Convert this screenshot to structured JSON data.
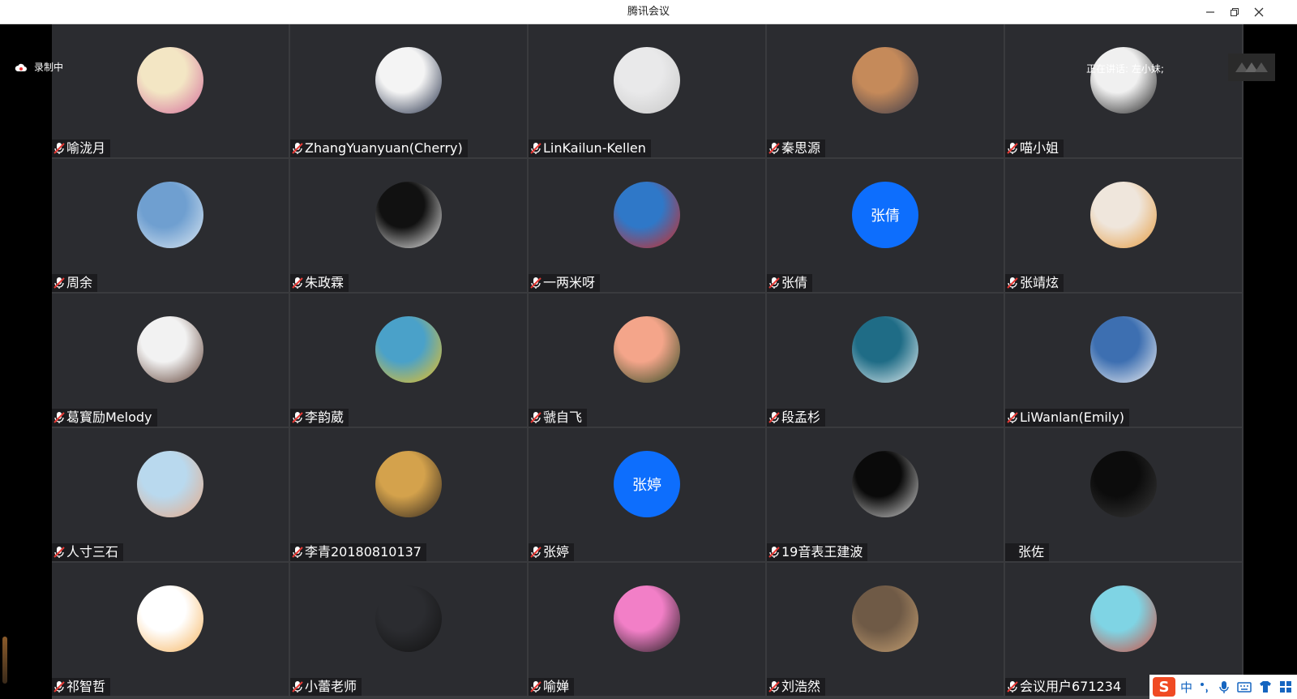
{
  "window": {
    "title": "腾讯会议"
  },
  "status": {
    "recording_label": "录制中",
    "speaking_label": "正在讲话: 左小妹;"
  },
  "colors": {
    "tile_bg": "#2b2c30",
    "text_avatar_bg": "#0d6efd",
    "recording_icon": "#ffffff"
  },
  "participants": [
    {
      "name": "喻泷月",
      "muted": true,
      "avatar_icon": "cartoon-girl-avatar",
      "avatar_colors": [
        "#f3e6c4",
        "#d46a9a"
      ]
    },
    {
      "name": "ZhangYuanyuan(Cherry)",
      "muted": true,
      "avatar_icon": "woman-photo-avatar",
      "avatar_colors": [
        "#f4f4f4",
        "#1f2a44"
      ]
    },
    {
      "name": "LinKailun-Kellen",
      "muted": true,
      "avatar_icon": "man-white-shirt-avatar",
      "avatar_colors": [
        "#e9e9ea",
        "#c7c7c7"
      ]
    },
    {
      "name": "秦思源",
      "muted": true,
      "avatar_icon": "sunset-lake-avatar",
      "avatar_colors": [
        "#c58a5a",
        "#3a3a4a"
      ]
    },
    {
      "name": "喵小姐",
      "muted": true,
      "avatar_icon": "dark-figure-avatar",
      "avatar_colors": [
        "#f0f0f0",
        "#1a1a1a"
      ]
    },
    {
      "name": "周余",
      "muted": true,
      "avatar_icon": "snow-mountain-avatar",
      "avatar_colors": [
        "#6f9fd0",
        "#dde8f2"
      ]
    },
    {
      "name": "朱政霖",
      "muted": true,
      "avatar_icon": "black-white-plush-avatar",
      "avatar_colors": [
        "#111111",
        "#f3f3f3"
      ]
    },
    {
      "name": "一两米呀",
      "muted": true,
      "avatar_icon": "red-hat-girl-avatar",
      "avatar_colors": [
        "#2f78c8",
        "#d3271f"
      ]
    },
    {
      "name": "张倩",
      "muted": true,
      "avatar_text": "张倩"
    },
    {
      "name": "张靖炫",
      "muted": true,
      "avatar_icon": "girl-tiger-illustration-avatar",
      "avatar_colors": [
        "#efe6dc",
        "#e69a3c"
      ]
    },
    {
      "name": "葛寳励Melody",
      "muted": true,
      "avatar_icon": "woman-flowers-avatar",
      "avatar_colors": [
        "#f2f2f2",
        "#5a3a2e"
      ]
    },
    {
      "name": "李韵葳",
      "muted": true,
      "avatar_icon": "yellow-flower-avatar",
      "avatar_colors": [
        "#4aa1c9",
        "#f1c21b"
      ]
    },
    {
      "name": "虢自飞",
      "muted": true,
      "avatar_icon": "pink-rose-avatar",
      "avatar_colors": [
        "#f4a58a",
        "#2e4a22"
      ]
    },
    {
      "name": "段孟杉",
      "muted": true,
      "avatar_icon": "ocean-wave-avatar",
      "avatar_colors": [
        "#1f6c86",
        "#e7f1f3"
      ]
    },
    {
      "name": "LiWanlan(Emily)",
      "muted": true,
      "avatar_icon": "woman-santorini-avatar",
      "avatar_colors": [
        "#3d6fb1",
        "#f3f3f3"
      ]
    },
    {
      "name": "人寸三石",
      "muted": true,
      "avatar_icon": "hands-avatar",
      "avatar_colors": [
        "#b9d9ee",
        "#e8a985"
      ]
    },
    {
      "name": "李青20180810137",
      "muted": true,
      "avatar_icon": "woman-golden-avatar",
      "avatar_colors": [
        "#d4a24c",
        "#2a221c"
      ]
    },
    {
      "name": "张婷",
      "muted": true,
      "avatar_text": "张婷"
    },
    {
      "name": "19音表王建波",
      "muted": true,
      "avatar_icon": "bw-face-avatar",
      "avatar_colors": [
        "#0a0a0a",
        "#d8d8d8"
      ]
    },
    {
      "name": "张佐",
      "muted": false,
      "avatar_icon": "dark-man-avatar",
      "avatar_colors": [
        "#0c0c0c",
        "#3a3a3a"
      ]
    },
    {
      "name": "祁智哲",
      "muted": true,
      "avatar_icon": "cartoon-tiger-avatar",
      "avatar_colors": [
        "#ffffff",
        "#f6b25a"
      ]
    },
    {
      "name": "小蕾老师",
      "muted": true,
      "avatar_icon": "woman-black-dress-avatar",
      "avatar_colors": [
        "#2b2c30",
        "#111111"
      ]
    },
    {
      "name": "喻婵",
      "muted": true,
      "avatar_icon": "pink-leopard-avatar",
      "avatar_colors": [
        "#f27fc7",
        "#1a1a1a"
      ]
    },
    {
      "name": "刘浩然",
      "muted": true,
      "avatar_icon": "man-walking-avatar",
      "avatar_colors": [
        "#6f5a46",
        "#c7a173"
      ]
    },
    {
      "name": "会议用户671234",
      "muted": true,
      "avatar_icon": "king-monkey-avatar",
      "avatar_colors": [
        "#7fd4e4",
        "#d24a3a"
      ]
    }
  ],
  "ime": {
    "logo": "S",
    "mode": "中",
    "icons": [
      "punctuation-icon",
      "microphone-icon",
      "keyboard-icon",
      "skin-icon",
      "toolbox-icon"
    ]
  }
}
